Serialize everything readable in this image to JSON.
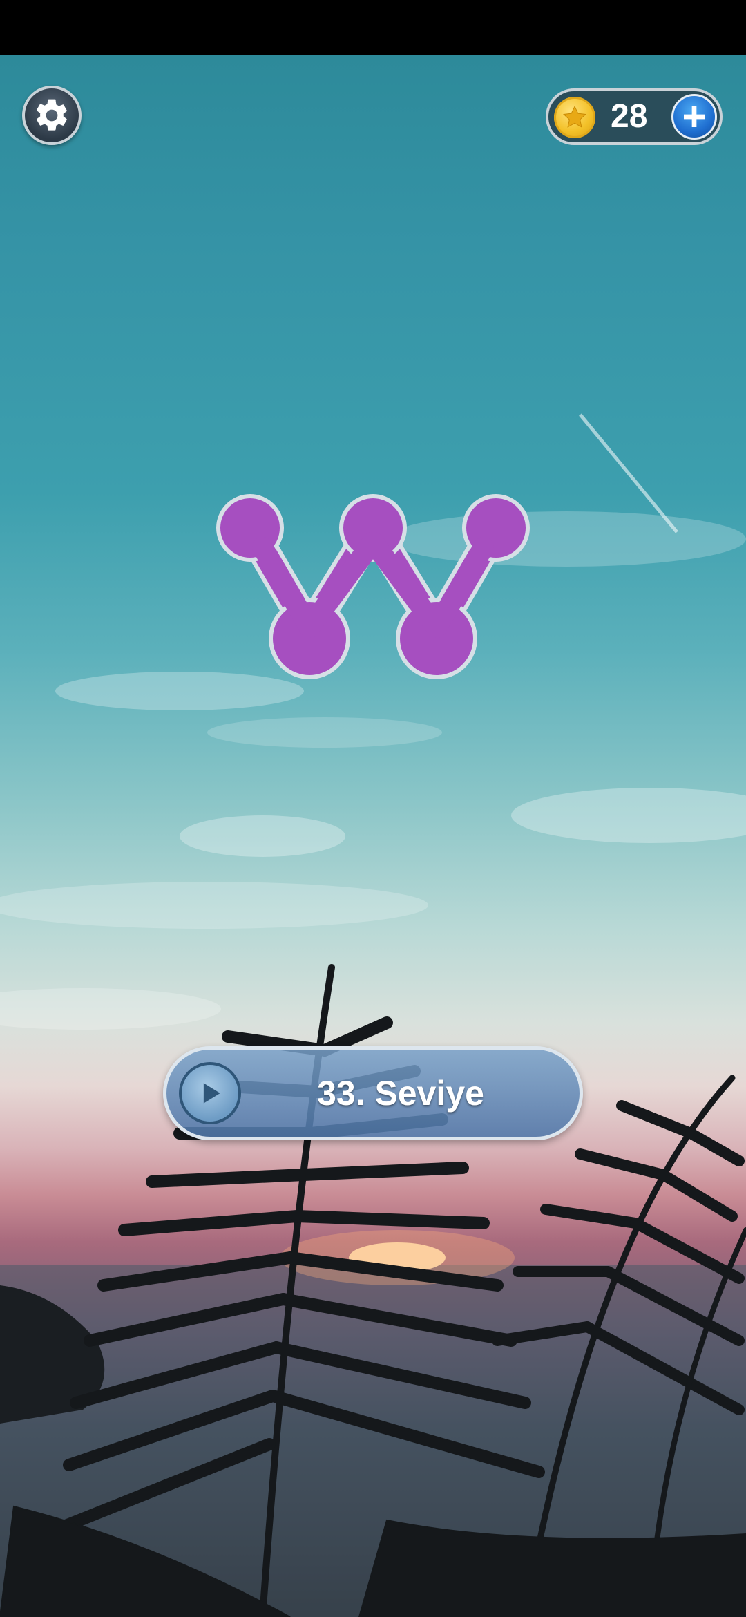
{
  "header": {
    "settings_icon": "gear-icon",
    "coins": {
      "icon": "coin-star-icon",
      "count": "28",
      "add_icon": "plus-icon"
    }
  },
  "logo": {
    "letter": "W",
    "color": "#a64fc0"
  },
  "play_button": {
    "icon": "play-icon",
    "label": "33. Seviye"
  },
  "colors": {
    "sky_top": "#2d8a9a",
    "sky_mid": "#b9d9d6",
    "sunset": "#c98c95",
    "coin": "#f3c129",
    "add_button": "#1f6ed0"
  }
}
